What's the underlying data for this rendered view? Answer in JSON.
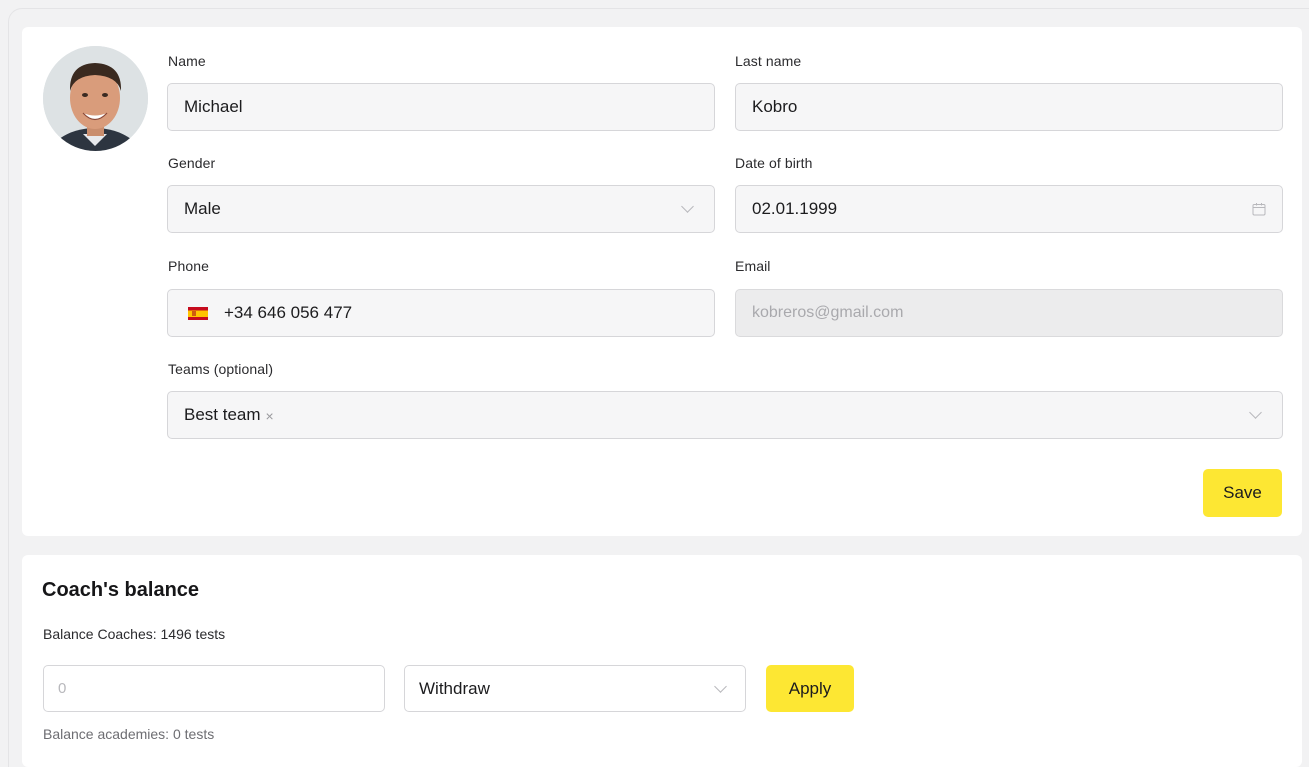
{
  "profile": {
    "avatar_alt": "Profile photo",
    "fields": {
      "name": {
        "label": "Name",
        "value": "Michael"
      },
      "last_name": {
        "label": "Last name",
        "value": "Kobro"
      },
      "gender": {
        "label": "Gender",
        "value": "Male",
        "icon": "chevron-down-icon"
      },
      "date_of_birth": {
        "label": "Date of birth",
        "value": "02.01.1999",
        "icon": "calendar-icon"
      },
      "phone": {
        "label": "Phone",
        "value": "+34 646 056 477",
        "flag": "spain-flag-icon"
      },
      "email": {
        "label": "Email",
        "value": "kobreros@gmail.com",
        "disabled": true
      },
      "teams": {
        "label": "Teams (optional)",
        "tags": [
          "Best team"
        ],
        "remove_glyph": "×",
        "icon": "chevron-down-icon"
      }
    },
    "save_label": "Save"
  },
  "balance": {
    "title": "Coach's balance",
    "coaches_text": "Balance Coaches: 1496 tests",
    "amount_placeholder": "0",
    "action_value": "Withdraw",
    "apply_label": "Apply",
    "academies_text": "Balance academies: 0 tests"
  },
  "colors": {
    "accent_yellow": "#fde733",
    "page_bg": "#f2f2f3",
    "card_bg": "#ffffff",
    "field_bg": "#f6f6f7",
    "field_border": "#d6d6d9"
  }
}
